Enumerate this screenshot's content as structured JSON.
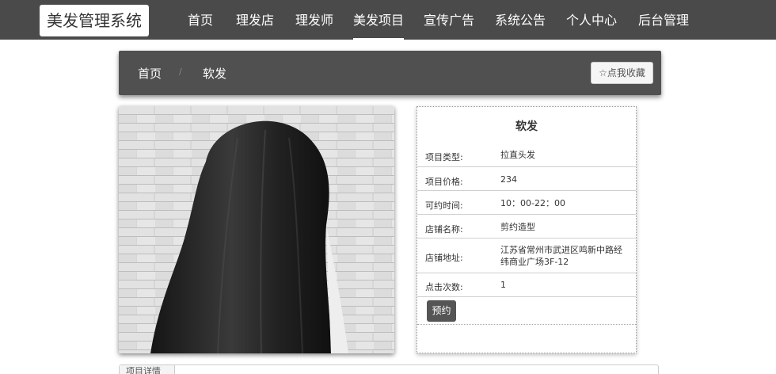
{
  "navbar": {
    "logo": "美发管理系统",
    "items": [
      {
        "label": "首页"
      },
      {
        "label": "理发店"
      },
      {
        "label": "理发师"
      },
      {
        "label": "美发项目",
        "active": true
      },
      {
        "label": "宣传广告"
      },
      {
        "label": "系统公告"
      },
      {
        "label": "个人中心"
      },
      {
        "label": "后台管理"
      }
    ]
  },
  "breadcrumb": {
    "home": "首页",
    "separator": "/",
    "current": "软发",
    "favorite_label": "☆点我收藏"
  },
  "detail": {
    "title": "软发",
    "rows": [
      {
        "label": "项目类型:",
        "value": "拉直头发"
      },
      {
        "label": "项目价格:",
        "value": "234"
      },
      {
        "label": "可约时间:",
        "value": "10：00-22：00"
      },
      {
        "label": "店铺名称:",
        "value": "剪约造型"
      },
      {
        "label": "店铺地址:",
        "value": "江苏省常州市武进区鸣新中路经纬商业广场3F-12"
      },
      {
        "label": "点击次数:",
        "value": "1"
      }
    ],
    "book_label": "预约"
  },
  "bottom_tab": {
    "label": "项目详情"
  },
  "colors": {
    "navbar": "#4a4a4a",
    "breadcrumb_bar": "#505050",
    "button": "#555555"
  }
}
